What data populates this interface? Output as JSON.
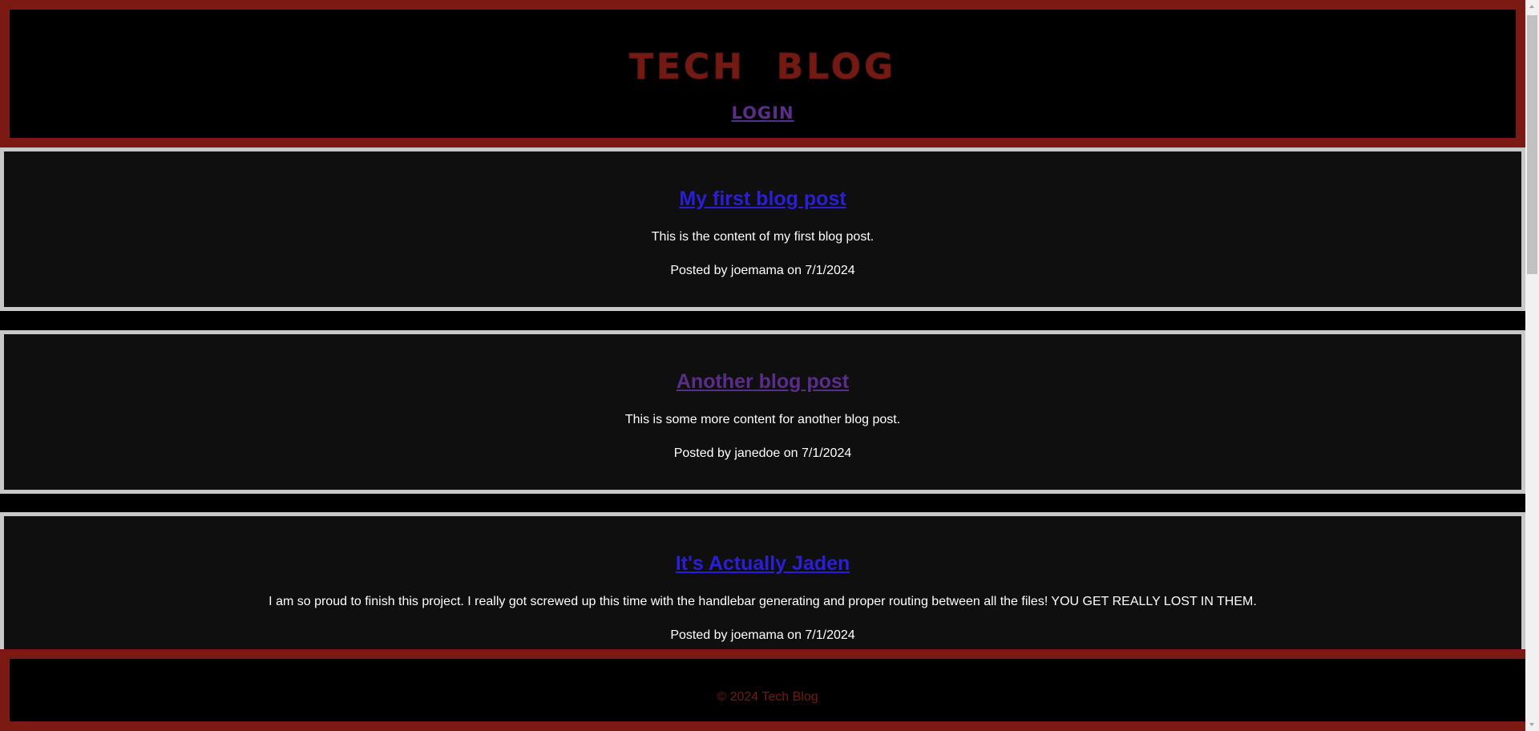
{
  "header": {
    "title": "TECH  BLOG",
    "login_label": "LOGIN"
  },
  "posts": [
    {
      "title": "My first blog post",
      "content": "This is the content of my first blog post.",
      "meta": "Posted by joemama on 7/1/2024",
      "link_state": "unvisited"
    },
    {
      "title": "Another blog post",
      "content": "This is some more content for another blog post.",
      "meta": "Posted by janedoe on 7/1/2024",
      "link_state": "visited"
    },
    {
      "title": "It's Actually Jaden",
      "content": "I am so proud to finish this project. I really got screwed up this time with the handlebar generating and proper routing between all the files! YOU GET REALLY LOST IN THEM.",
      "meta": "Posted by joemama on 7/1/2024",
      "link_state": "unvisited"
    }
  ],
  "footer": {
    "text": "© 2024 Tech Blog"
  },
  "colors": {
    "header_border": "#7a1a12",
    "title": "#741a14",
    "link_unvisited": "#2a1ed6",
    "link_visited": "#5a2d8a",
    "post_border": "#c8c8c8",
    "post_bg": "#0f0f0f"
  }
}
